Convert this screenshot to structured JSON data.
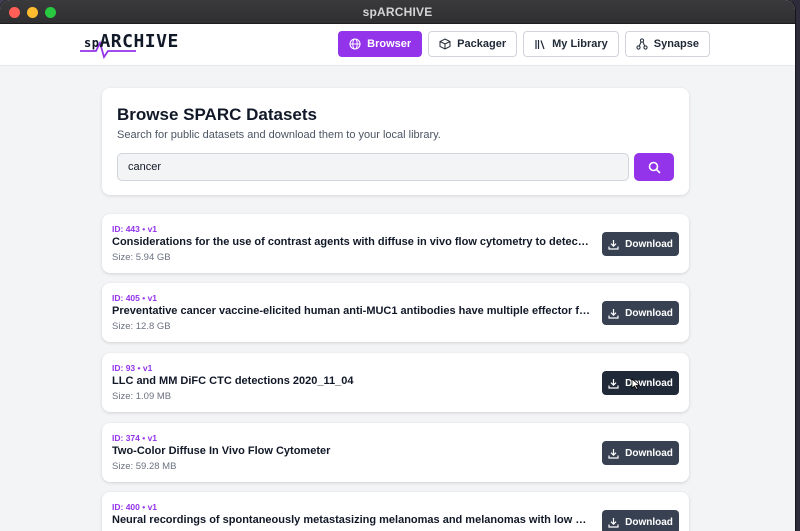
{
  "window": {
    "title": "spARCHIVE"
  },
  "logo": {
    "prefix": "sp",
    "main": "ARCHIVE"
  },
  "nav": [
    {
      "label": "Browser",
      "icon": "globe-icon",
      "active": true
    },
    {
      "label": "Packager",
      "icon": "package-icon",
      "active": false
    },
    {
      "label": "My Library",
      "icon": "library-icon",
      "active": false
    },
    {
      "label": "Synapse",
      "icon": "network-icon",
      "active": false
    }
  ],
  "search": {
    "heading": "Browse SPARC Datasets",
    "subtitle": "Search for public datasets and download them to your local library.",
    "value": "cancer",
    "button_icon": "search-icon"
  },
  "results": [
    {
      "meta": "ID: 443 • v1",
      "title": "Considerations for the use of contrast agents with diffuse in vivo flow cytometry to detect circulating tumor cells",
      "size": "Size: 5.94 GB",
      "button": "Download"
    },
    {
      "meta": "ID: 405 • v1",
      "title": "Preventative cancer vaccine-elicited human anti-MUC1 antibodies have multiple effector functions",
      "size": "Size: 12.8 GB",
      "button": "Download"
    },
    {
      "meta": "ID: 93 • v1",
      "title": "LLC and MM DiFC CTC detections 2020_11_04",
      "size": "Size: 1.09 MB",
      "button": "Download"
    },
    {
      "meta": "ID: 374 • v1",
      "title": "Two-Color Diffuse In Vivo Flow Cytometer",
      "size": "Size: 59.28 MB",
      "button": "Download"
    },
    {
      "meta": "ID: 400 • v1",
      "title": "Neural recordings of spontaneously metastasizing melanomas and melanomas with low metastatic potential",
      "size": "",
      "button": "Download"
    }
  ],
  "colors": {
    "accent": "#9333ea",
    "download": "#374151"
  }
}
